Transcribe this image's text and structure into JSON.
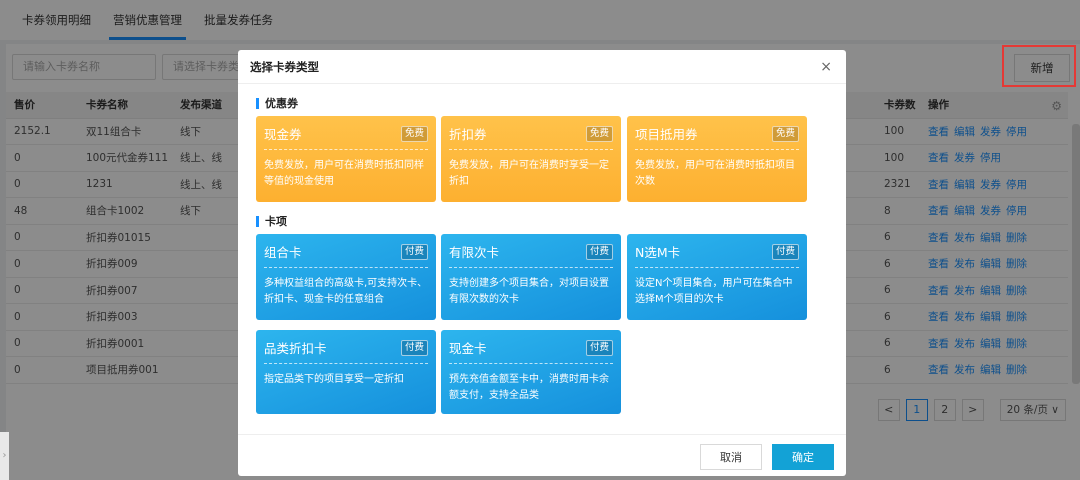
{
  "tabs": [
    "卡券领用明细",
    "营销优惠管理",
    "批量发券任务"
  ],
  "filters": {
    "name_placeholder": "请输入卡券名称",
    "type_placeholder": "请选择卡券类"
  },
  "toolbar": {
    "new_label": "新增"
  },
  "table": {
    "headers": [
      "售价",
      "卡券名称",
      "发布渠道",
      "卡券数",
      "操作"
    ],
    "rows": [
      {
        "price": "2152.1",
        "name": "双11组合卡",
        "channel": "线下",
        "count": "100",
        "ops": [
          "查看",
          "编辑",
          "发券",
          "停用"
        ]
      },
      {
        "price": "0",
        "name": "100元代金券111",
        "channel": "线上、线",
        "count": "100",
        "ops": [
          "查看",
          "发券",
          "停用"
        ]
      },
      {
        "price": "0",
        "name": "1231",
        "channel": "线上、线",
        "count": "2321",
        "ops": [
          "查看",
          "编辑",
          "发券",
          "停用"
        ]
      },
      {
        "price": "48",
        "name": "组合卡1002",
        "channel": "线下",
        "count": "8",
        "ops": [
          "查看",
          "编辑",
          "发券",
          "停用"
        ]
      },
      {
        "price": "0",
        "name": "折扣券01015",
        "channel": "",
        "count": "6",
        "ops": [
          "查看",
          "发布",
          "编辑",
          "删除"
        ]
      },
      {
        "price": "0",
        "name": "折扣券009",
        "channel": "",
        "count": "6",
        "ops": [
          "查看",
          "发布",
          "编辑",
          "删除"
        ]
      },
      {
        "price": "0",
        "name": "折扣券007",
        "channel": "",
        "count": "6",
        "ops": [
          "查看",
          "发布",
          "编辑",
          "删除"
        ]
      },
      {
        "price": "0",
        "name": "折扣券003",
        "channel": "",
        "count": "6",
        "ops": [
          "查看",
          "发布",
          "编辑",
          "删除"
        ]
      },
      {
        "price": "0",
        "name": "折扣券0001",
        "channel": "",
        "count": "6",
        "ops": [
          "查看",
          "发布",
          "编辑",
          "删除"
        ]
      },
      {
        "price": "0",
        "name": "项目抵用券001",
        "channel": "",
        "count": "6",
        "ops": [
          "查看",
          "发布",
          "编辑",
          "删除"
        ]
      }
    ]
  },
  "pagination": {
    "prev": "<",
    "pages": [
      "1",
      "2"
    ],
    "next": ">",
    "size": "20 条/页"
  },
  "modal": {
    "title": "选择卡券类型",
    "close": "×",
    "section_coupon": "优惠券",
    "section_card": "卡项",
    "coupons": [
      {
        "title": "现金券",
        "badge": "免费",
        "desc": "免费发放，用户可在消费时抵扣同样等值的现金使用"
      },
      {
        "title": "折扣券",
        "badge": "免费",
        "desc": "免费发放，用户可在消费时享受一定折扣"
      },
      {
        "title": "项目抵用券",
        "badge": "免费",
        "desc": "免费发放，用户可在消费时抵扣项目次数"
      }
    ],
    "cards": [
      {
        "title": "组合卡",
        "badge": "付费",
        "desc": "多种权益组合的高级卡,可支持次卡、折扣卡、现金卡的任意组合"
      },
      {
        "title": "有限次卡",
        "badge": "付费",
        "desc": "支持创建多个项目集合，对项目设置有限次数的次卡"
      },
      {
        "title": "N选M卡",
        "badge": "付费",
        "desc": "设定N个项目集合，用户可在集合中选择M个项目的次卡"
      },
      {
        "title": "品类折扣卡",
        "badge": "付费",
        "desc": "指定品类下的项目享受一定折扣"
      },
      {
        "title": "现金卡",
        "badge": "付费",
        "desc": "预先充值金额至卡中，消费时用卡余额支付，支持全品类"
      }
    ],
    "cancel": "取消",
    "ok": "确定"
  }
}
